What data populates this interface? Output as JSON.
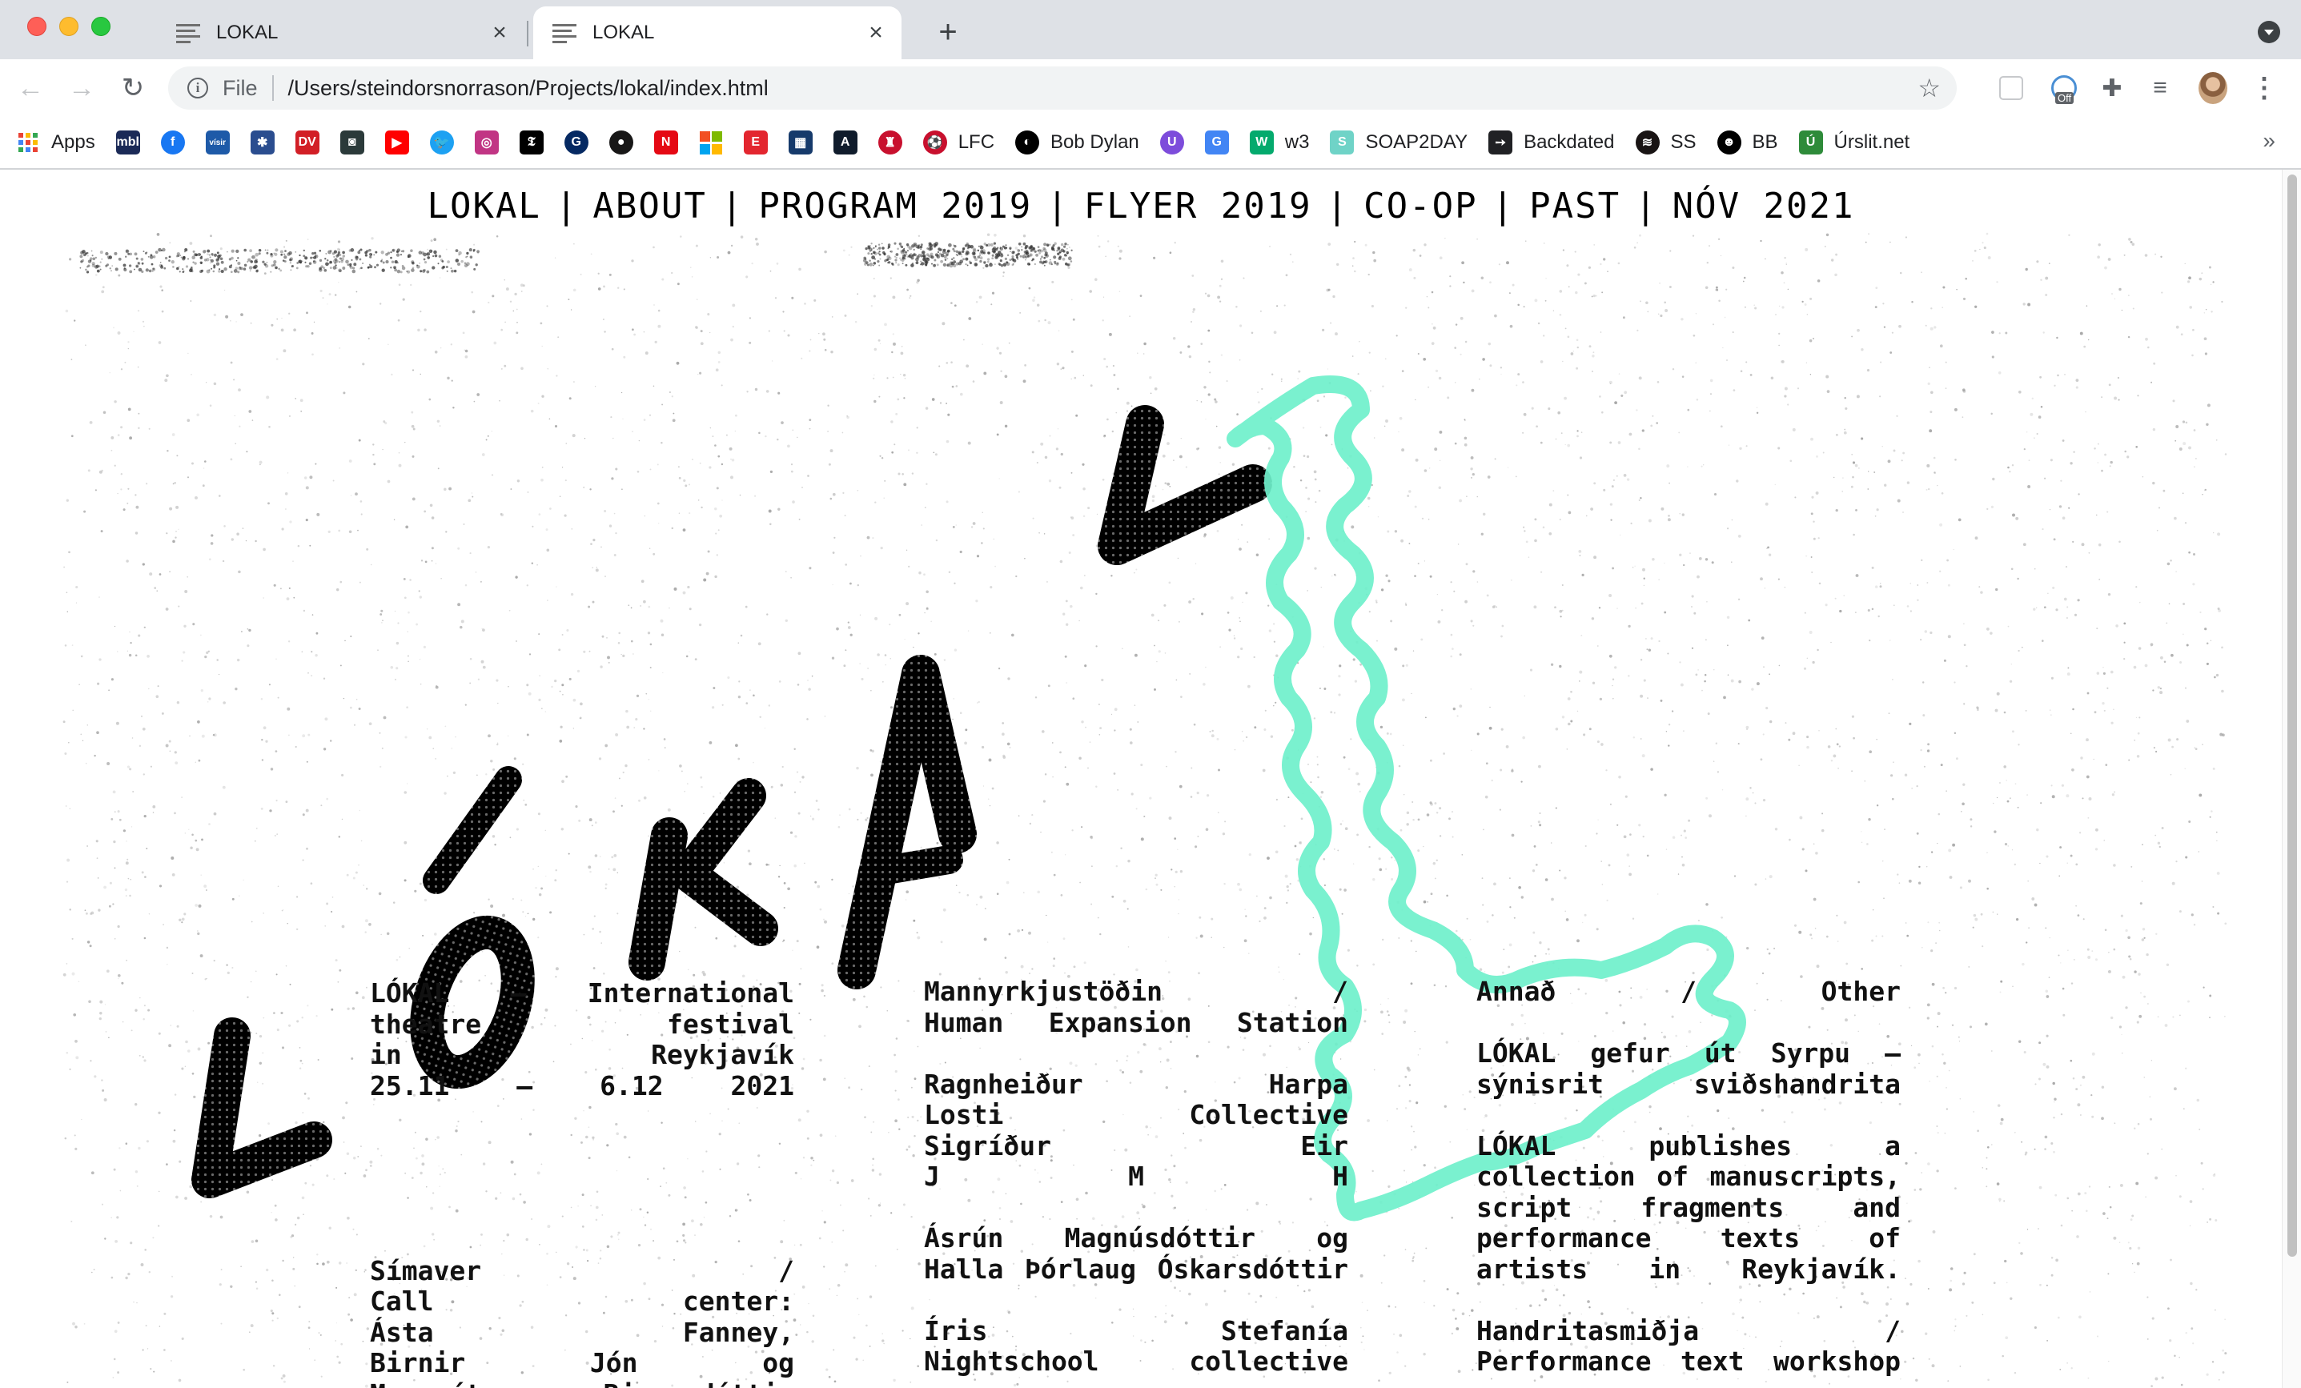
{
  "browser": {
    "tabs": [
      {
        "label": "LOKAL",
        "active": false
      },
      {
        "label": "LOKAL",
        "active": true
      }
    ],
    "url_scheme": "File",
    "url": "/Users/steindorsnorrason/Projects/lokal/index.html",
    "extension_badge": "Off",
    "bookmarks": [
      {
        "label": "Apps",
        "icon": "apps-grid-icon"
      },
      {
        "label": "",
        "icon": "mbl-icon",
        "glyph": "mbl",
        "color": "#1b2a57"
      },
      {
        "label": "",
        "icon": "facebook-icon",
        "glyph": "f",
        "color": "#1877f2"
      },
      {
        "label": "",
        "icon": "visir-icon",
        "glyph": "vísir",
        "color": "#1e5aa8"
      },
      {
        "label": "",
        "icon": "ruv-icon",
        "glyph": "✱",
        "color": "#2a4d8f"
      },
      {
        "label": "",
        "icon": "dv-icon",
        "glyph": "DV",
        "color": "#d21f26"
      },
      {
        "label": "",
        "icon": "kjarninn-icon",
        "glyph": "◙",
        "color": "#2b3a3a"
      },
      {
        "label": "",
        "icon": "youtube-icon",
        "glyph": "▶",
        "color": "#ff0000"
      },
      {
        "label": "",
        "icon": "twitter-icon",
        "glyph": "🐦",
        "color": "#1da1f2"
      },
      {
        "label": "",
        "icon": "instagram-icon",
        "glyph": "◎",
        "color": "#c13584"
      },
      {
        "label": "",
        "icon": "nytimes-icon",
        "glyph": "𝕿",
        "color": "#000000"
      },
      {
        "label": "",
        "icon": "guardian-icon",
        "glyph": "G",
        "color": "#052962"
      },
      {
        "label": "",
        "icon": "github-icon",
        "glyph": "●",
        "color": "#181717"
      },
      {
        "label": "",
        "icon": "netflix-icon",
        "glyph": "N",
        "color": "#e50914"
      },
      {
        "label": "",
        "icon": "microsoft-icon",
        "glyph": "",
        "color": "#f25022"
      },
      {
        "label": "",
        "icon": "ebook-icon",
        "glyph": "E",
        "color": "#e3262f"
      },
      {
        "label": "",
        "icon": "newspaper-icon",
        "glyph": "▦",
        "color": "#163a6b"
      },
      {
        "label": "",
        "icon": "atlantic-icon",
        "glyph": "A",
        "color": "#101c2c"
      },
      {
        "label": "",
        "icon": "liverpool-crest-icon",
        "glyph": "♜",
        "color": "#c8102e"
      },
      {
        "label": "LFC",
        "icon": "lfc-icon",
        "glyph": "⚽",
        "color": "#c8102e"
      },
      {
        "label": "Bob Dylan",
        "icon": "bobdylan-icon",
        "glyph": "◐",
        "color": "#000000"
      },
      {
        "label": "",
        "icon": "tor-icon",
        "glyph": "U",
        "color": "#7d4cdb"
      },
      {
        "label": "",
        "icon": "translate-icon",
        "glyph": "G",
        "color": "#4285f4"
      },
      {
        "label": "w3",
        "icon": "w3-icon",
        "glyph": "W",
        "color": "#04aa6d"
      },
      {
        "label": "SOAP2DAY",
        "icon": "soap2day-icon",
        "glyph": "S",
        "color": "#6fd3c7"
      },
      {
        "label": "Backdated",
        "icon": "arrow-icon",
        "glyph": "➙",
        "color": "#202124"
      },
      {
        "label": "SS",
        "icon": "spotify-icon",
        "glyph": "≋",
        "color": "#191414"
      },
      {
        "label": "BB",
        "icon": "bb-icon",
        "glyph": "☻",
        "color": "#000000"
      },
      {
        "label": "Úrslit.net",
        "icon": "urslit-icon",
        "glyph": "Ú",
        "color": "#2e8b3a"
      }
    ]
  },
  "site": {
    "nav": [
      "LOKAL",
      "ABOUT",
      "PROGRAM 2019",
      "FLYER 2019",
      "CO-OP",
      "PAST",
      "NÓV 2021"
    ],
    "nav_separator": "|",
    "logo_text": "LÓKAL",
    "accent_color": "#6ff0cb",
    "col1": {
      "intro": [
        "LÓKAL – International",
        "theatre festival",
        "in Reykjavík",
        "25.11 – 6.12 2021"
      ],
      "callcenter": [
        "Símaver /",
        "Call center:",
        "Ásta Fanney,",
        "Birnir Jón og",
        "Margrét Bjarnadóttir"
      ]
    },
    "col2": {
      "head": [
        "Mannyrkjustöðin /",
        "Human Expansion Station"
      ],
      "names1": [
        "Ragnheiður Harpa",
        "Losti Collective",
        "Sigríður Eir",
        "J M H"
      ],
      "names2": [
        "Ásrún Magnúsdóttir og",
        "Halla Þórlaug Óskarsdóttir"
      ],
      "names3": [
        "Íris Stefanía",
        "Nightschool collective"
      ]
    },
    "col3": {
      "head": [
        "Annað / Other"
      ],
      "p1": [
        "LÓKAL gefur út Syrpu –",
        "sýnisrit sviðshandrita"
      ],
      "p2": [
        "LÓKAL publishes a",
        "collection of manuscripts,",
        "script fragments and",
        "performance texts of",
        "artists in Reykjavík."
      ],
      "p3": [
        "Handritasmiðja /",
        "Performance text workshop"
      ]
    }
  }
}
